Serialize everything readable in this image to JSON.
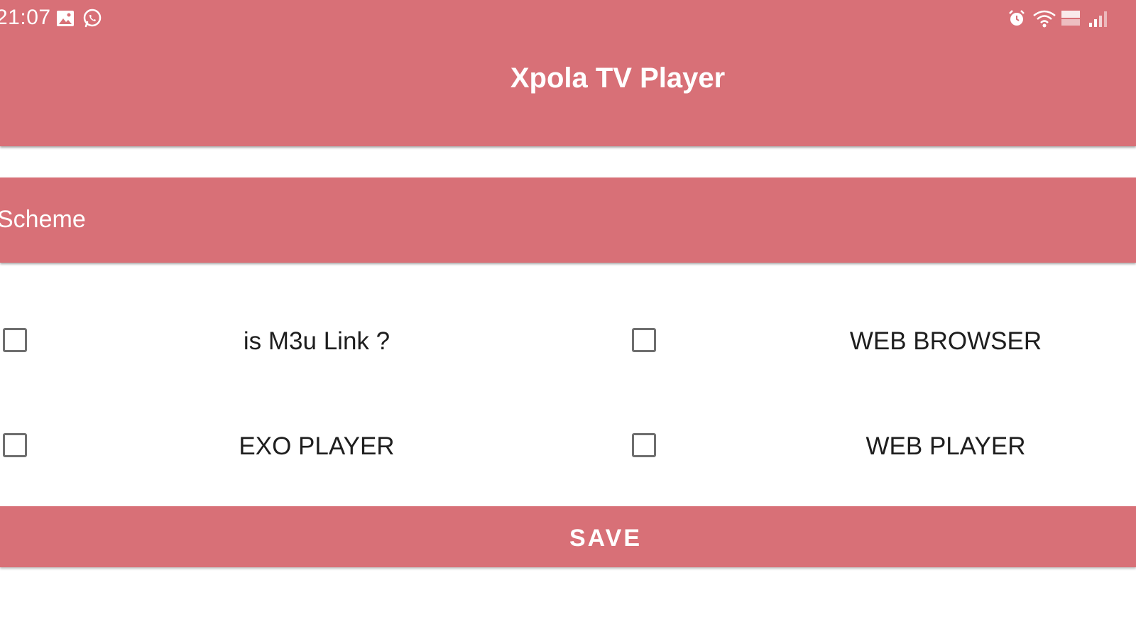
{
  "status_bar": {
    "time": "21:07",
    "left_icons": [
      "image-icon",
      "whatsapp-icon"
    ],
    "right_icons": [
      "alarm-icon",
      "wifi-icon",
      "volte-icon",
      "signal-icon"
    ]
  },
  "app_bar": {
    "title": "Xpola TV Player"
  },
  "scheme": {
    "label": "Scheme"
  },
  "options": [
    {
      "label": "is M3u Link ?",
      "checked": false
    },
    {
      "label": "WEB BROWSER",
      "checked": false
    },
    {
      "label": "EXO PLAYER",
      "checked": false
    },
    {
      "label": "WEB PLAYER",
      "checked": false
    }
  ],
  "save_button": {
    "label": "SAVE"
  },
  "colors": {
    "accent": "#d87077",
    "background": "#ffffff",
    "text": "#1e1e1e",
    "checkbox_border": "#6e6e6e"
  }
}
